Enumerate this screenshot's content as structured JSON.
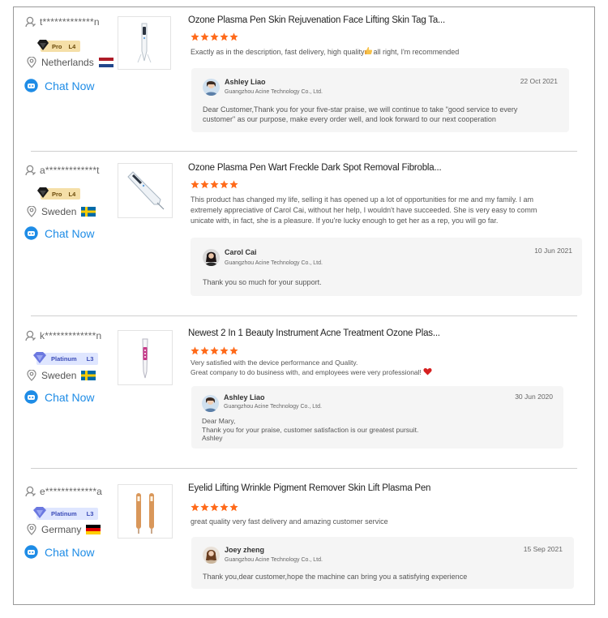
{
  "colors": {
    "star": "#ff6a1a",
    "chat": "#1e8ce6",
    "heart": "#d62020"
  },
  "reviews": [
    {
      "buyer": "t*************n",
      "level_kind": "pro",
      "level_label": "Pro",
      "level": "L4",
      "country": "Netherlands",
      "flag": "netherlands-flag",
      "chat_label": "Chat Now",
      "product_title": "Ozone Plasma Pen Skin Rejuvenation Face Lifting Skin Tag Ta...",
      "rating": 5,
      "text_lines": [
        "Exactly as in the description, fast delivery, high quality",
        "all right, I'm recommended"
      ],
      "reply": {
        "name": "Ashley Liao",
        "company": "Guangzhou Acine Technology Co., Ltd.",
        "date": "22 Oct 2021",
        "lines": [
          "Dear Customer,Thank you for your five-star praise, we will continue to take \"good service to every",
          "customer\" as our purpose, make every order well, and look forward to our next cooperation"
        ]
      }
    },
    {
      "buyer": "a*************t",
      "level_kind": "pro",
      "level_label": "Pro",
      "level": "L4",
      "country": "Sweden",
      "flag": "sweden-flag",
      "chat_label": "Chat Now",
      "product_title": "Ozone Plasma Pen Wart Freckle Dark Spot Removal Fibrobla...",
      "rating": 5,
      "text_lines": [
        "This product has changed my life, selling it has opened up a lot of opportunities for me and my family. I am",
        "extremely appreciative of Carol Cai, without her help, I wouldn't have succeeded. She is very easy to comm",
        "unicate with, in fact, she is a pleasure. If you're lucky enough to get her as a rep, you will go far."
      ],
      "reply": {
        "name": "Carol Cai",
        "company": "Guangzhou Acine Technology Co., Ltd.",
        "date": "10 Jun 2021",
        "lines": [
          "Thank you so much for your support."
        ]
      }
    },
    {
      "buyer": "k*************n",
      "level_kind": "platinum",
      "level_label": "Platinum",
      "level": "L3",
      "country": "Sweden",
      "flag": "sweden-flag",
      "chat_label": "Chat Now",
      "product_title": "Newest 2 In 1 Beauty Instrument Acne Treatment Ozone Plas...",
      "rating": 5,
      "text_lines": [
        "Very satisfied with the device performance and Quality.",
        "Great company to do business with, and employees were very professional!"
      ],
      "reply": {
        "name": "Ashley Liao",
        "company": "Guangzhou Acine Technology Co., Ltd.",
        "date": "30 Jun 2020",
        "lines": [
          "Dear Mary,",
          "Thank you for your praise, customer satisfaction is our greatest pursuit.",
          "Ashley"
        ]
      }
    },
    {
      "buyer": "e*************a",
      "level_kind": "platinum",
      "level_label": "Platinum",
      "level": "L3",
      "country": "Germany",
      "flag": "germany-flag",
      "chat_label": "Chat Now",
      "product_title": "Eyelid Lifting Wrinkle Pigment Remover Skin Lift Plasma Pen",
      "rating": 5,
      "text_lines": [
        "great quality very fast delivery and amazing customer service"
      ],
      "reply": {
        "name": "Joey zheng",
        "company": "Guangzhou Acine Technology Co., Ltd.",
        "date": "15 Sep 2021",
        "lines": [
          "Thank you,dear customer,hope the machine can bring you a satisfying experience"
        ]
      }
    }
  ]
}
